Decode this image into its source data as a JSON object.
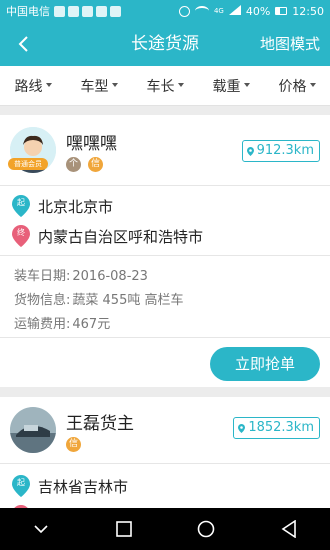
{
  "statusbar": {
    "carrier": "中国电信",
    "battery": "40%",
    "time": "12:50",
    "signal": "4G"
  },
  "header": {
    "title": "长途货源",
    "map_mode": "地图模式"
  },
  "filters": [
    {
      "label": "路线"
    },
    {
      "label": "车型"
    },
    {
      "label": "车长"
    },
    {
      "label": "载重"
    },
    {
      "label": "价格"
    }
  ],
  "cards": [
    {
      "name": "嘿嘿嘿",
      "member_badge": "普通会员",
      "tags": [
        "个",
        "信"
      ],
      "distance": "912.3km",
      "from_pin": "起",
      "from": "北京北京市",
      "to_pin": "终",
      "to": "内蒙古自治区呼和浩特市",
      "load_date_label": "装车日期:",
      "load_date": "2016-08-23",
      "goods_label": "货物信息:",
      "goods": "蔬菜 455吨 高栏车",
      "fee_label": "运输费用:",
      "fee": "467元",
      "action": "立即抢单"
    },
    {
      "name": "王磊货主",
      "tags": [
        "信"
      ],
      "distance": "1852.3km",
      "from_pin": "起",
      "from": "吉林省吉林市"
    }
  ],
  "colors": {
    "accent": "#2bb6c8",
    "from_pin": "#2bb6c8",
    "to_pin": "#e8607a",
    "badge": "#f2a32a"
  }
}
